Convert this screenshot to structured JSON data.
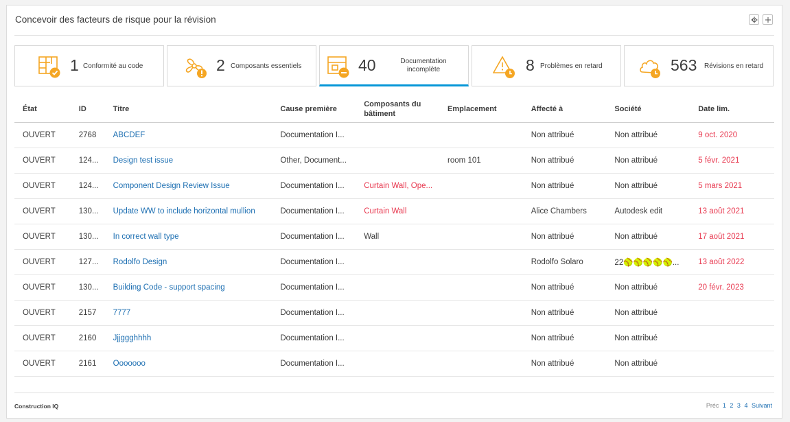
{
  "card": {
    "title": "Concevoir des facteurs de risque pour la révision"
  },
  "header_buttons": {
    "settings_icon": "gear-icon",
    "expand_icon": "plus-icon"
  },
  "tiles": [
    {
      "count": "1",
      "label": "Conformité au code",
      "icon": "code-compliance-icon"
    },
    {
      "count": "2",
      "label": "Composants essentiels",
      "icon": "fan-warning-icon"
    },
    {
      "count": "40",
      "label": "Documentation incomplète",
      "icon": "document-minus-icon",
      "active": true
    },
    {
      "count": "8",
      "label": "Problèmes en retard",
      "icon": "warning-clock-icon"
    },
    {
      "count": "563",
      "label": "Révisions en retard",
      "icon": "cloud-clock-icon"
    }
  ],
  "table": {
    "columns": [
      "État",
      "ID",
      "Titre",
      "Cause première",
      "Composants du bâtiment",
      "Emplacement",
      "Affecté à",
      "Société",
      "Date lim."
    ],
    "rows": [
      {
        "state": "OUVERT",
        "id": "2768",
        "title": "ABCDEF",
        "cause": "Documentation I...",
        "components": "",
        "location": "",
        "assigned": "Non attribué",
        "company": "Non attribué",
        "due": "9 oct. 2020"
      },
      {
        "state": "OUVERT",
        "id": "124...",
        "title": "Design test issue",
        "cause": "Other, Document...",
        "components": "",
        "location": "room 101",
        "assigned": "Non attribué",
        "company": "Non attribué",
        "due": "5 févr. 2021"
      },
      {
        "state": "OUVERT",
        "id": "124...",
        "title": "Component Design Review Issue",
        "cause": "Documentation I...",
        "components": "Curtain Wall, Ope...",
        "location": "",
        "assigned": "Non attribué",
        "company": "Non attribué",
        "due": "5 mars 2021"
      },
      {
        "state": "OUVERT",
        "id": "130...",
        "title": "Update WW to include horizontal mullion",
        "cause": "Documentation I...",
        "components": "Curtain Wall",
        "location": "",
        "assigned": "Alice Chambers",
        "company": "Autodesk edit",
        "due": "13 août 2021"
      },
      {
        "state": "OUVERT",
        "id": "130...",
        "title": "In correct wall type",
        "cause": "Documentation I...",
        "components": "Wall",
        "location": "",
        "assigned": "Non attribué",
        "company": "Non attribué",
        "due": "17 août 2021"
      },
      {
        "state": "OUVERT",
        "id": "127...",
        "title": "Rodolfo Design",
        "cause": "Documentation I...",
        "components": "",
        "location": "",
        "assigned": "Rodolfo Solaro",
        "company": "22🥎🥎🥎🥎🥎...",
        "due": "13 août 2022"
      },
      {
        "state": "OUVERT",
        "id": "130...",
        "title": "Building Code - support spacing",
        "cause": "Documentation I...",
        "components": "",
        "location": "",
        "assigned": "Non attribué",
        "company": "Non attribué",
        "due": "20 févr. 2023"
      },
      {
        "state": "OUVERT",
        "id": "2157",
        "title": "7777",
        "cause": "Documentation I...",
        "components": "",
        "location": "",
        "assigned": "Non attribué",
        "company": "Non attribué",
        "due": ""
      },
      {
        "state": "OUVERT",
        "id": "2160",
        "title": "Jjjggghhhh",
        "cause": "Documentation I...",
        "components": "",
        "location": "",
        "assigned": "Non attribué",
        "company": "Non attribué",
        "due": ""
      },
      {
        "state": "OUVERT",
        "id": "2161",
        "title": "Ooooooo",
        "cause": "Documentation I...",
        "components": "",
        "location": "",
        "assigned": "Non attribué",
        "company": "Non attribué",
        "due": ""
      }
    ]
  },
  "footer": {
    "brand": "Construction IQ",
    "prev": "Préc",
    "pages": [
      "1",
      "2",
      "3",
      "4"
    ],
    "next": "Suivant"
  },
  "colors": {
    "accent": "#0696d7",
    "icon_orange": "#f5a623",
    "overdue": "#e8384f",
    "link": "#1d6fb2"
  }
}
